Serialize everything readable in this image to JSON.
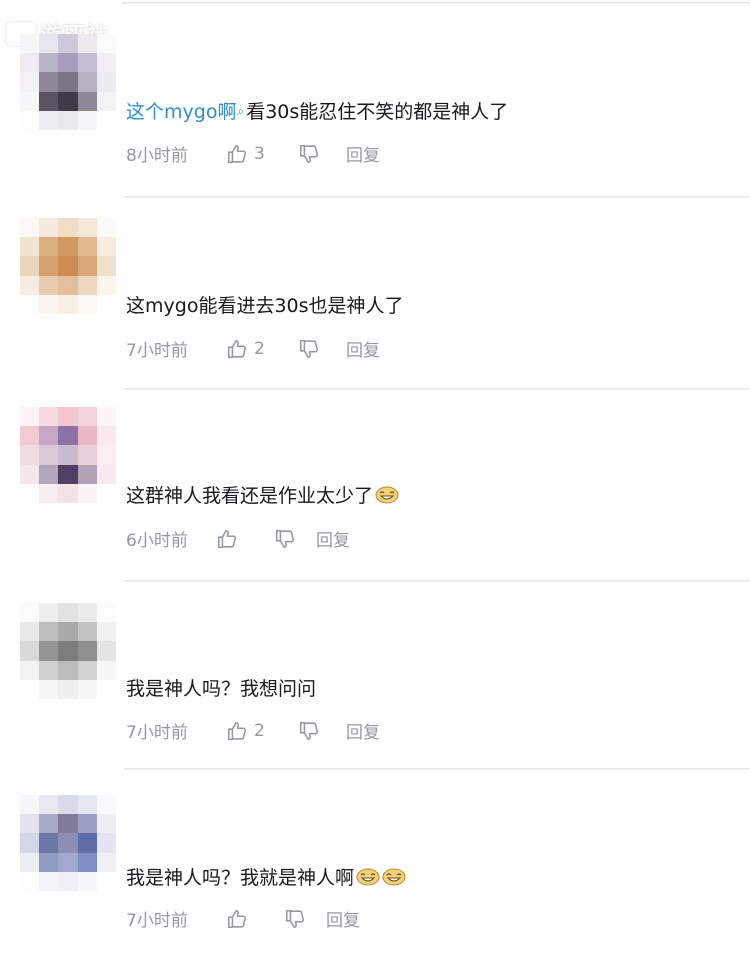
{
  "watermark": {
    "text": "游研社",
    "logo_icon": "game-controller-icon"
  },
  "colors": {
    "mention": "#2f8fc8",
    "meta_text": "#9499a0",
    "body_text": "#18191c",
    "divider": "#e3e5e7"
  },
  "comments": [
    {
      "mention": "这个mygo啊",
      "mention_icon": "search-icon",
      "text": "看30s能忍住不笑的都是神人了",
      "time": "8小时前",
      "likes": "3",
      "reply_label": "回复",
      "emoji_count": 0
    },
    {
      "mention": "",
      "text": "这mygo能看进去30s也是神人了",
      "time": "7小时前",
      "likes": "2",
      "reply_label": "回复",
      "emoji_count": 0
    },
    {
      "mention": "",
      "text": "这群神人我看还是作业太少了",
      "time": "6小时前",
      "likes": "",
      "reply_label": "回复",
      "emoji_count": 1
    },
    {
      "mention": "",
      "text": "我是神人吗？我想问问",
      "time": "7小时前",
      "likes": "2",
      "reply_label": "回复",
      "emoji_count": 0
    },
    {
      "mention": "",
      "text": "我是神人吗？我就是神人啊",
      "time": "7小时前",
      "likes": "",
      "reply_label": "回复",
      "emoji_count": 2
    }
  ]
}
